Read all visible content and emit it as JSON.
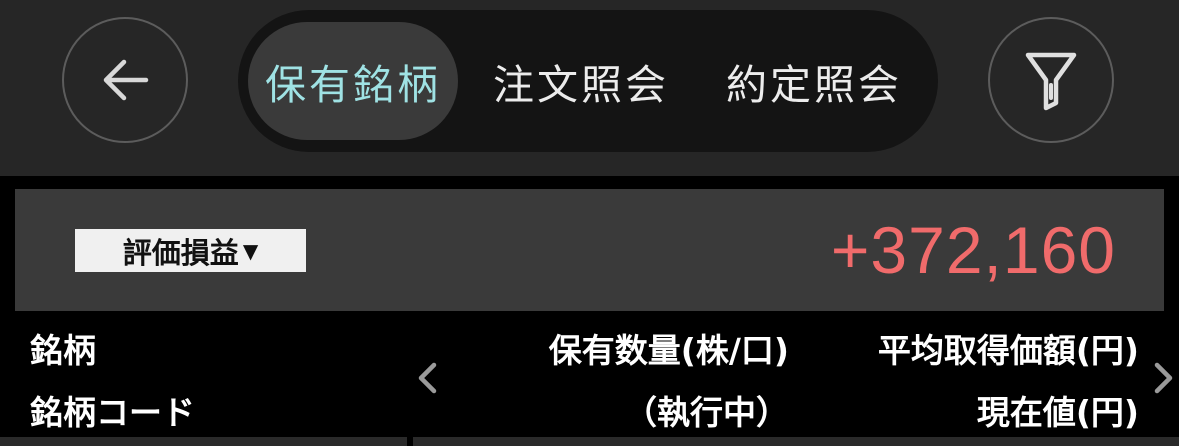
{
  "tabs": [
    {
      "label": "保有銘柄",
      "active": true
    },
    {
      "label": "注文照会",
      "active": false
    },
    {
      "label": "約定照会",
      "active": false
    }
  ],
  "summary": {
    "metric_label": "評価損益",
    "metric_value": "+372,160",
    "value_color": "#f06b6b"
  },
  "columns": {
    "left_line1": "銘柄",
    "left_line2": "銘柄コード",
    "mid_line1": "保有数量(株/口)",
    "mid_line2": "（執行中）",
    "right_line1": "平均取得価額(円)",
    "right_line2": "現在値(円)"
  },
  "icons": {
    "back": "arrow-left-icon",
    "filter": "filter-icon",
    "prev": "chevron-left-icon",
    "next": "chevron-right-icon",
    "dropdown": "caret-down-icon"
  },
  "colors": {
    "active_tab_text": "#9fe2e4",
    "header_bg": "#262626",
    "summary_bg": "#3a3a3a"
  }
}
